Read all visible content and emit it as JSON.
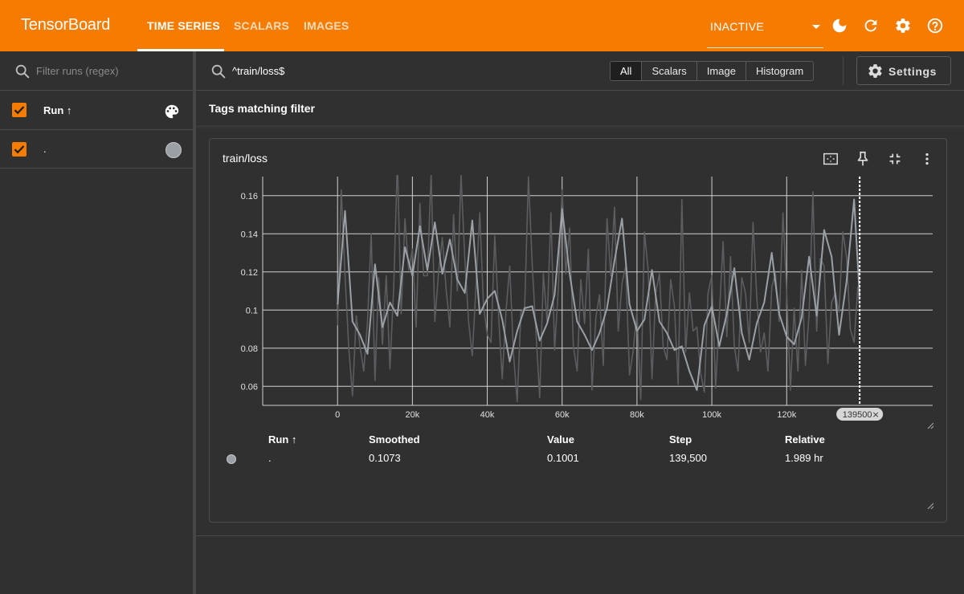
{
  "app": {
    "title": "TensorBoard"
  },
  "nav": {
    "tabs": [
      {
        "label": "TIME SERIES",
        "active": true
      },
      {
        "label": "SCALARS",
        "active": false
      },
      {
        "label": "IMAGES",
        "active": false
      }
    ],
    "reload_select": "INACTIVE",
    "icons": [
      "dark-mode-icon",
      "refresh-icon",
      "settings-icon",
      "help-icon"
    ]
  },
  "runs_panel": {
    "filter_placeholder": "Filter runs (regex)",
    "header_label": "Run ↑",
    "runs": [
      {
        "name": ".",
        "checked": true,
        "color": "#9aa0a6"
      }
    ]
  },
  "filter": {
    "query": "^train/loss$",
    "types": [
      "All",
      "Scalars",
      "Image",
      "Histogram"
    ],
    "active_type": "All",
    "settings_label": "Settings"
  },
  "section": {
    "title": "Tags matching filter"
  },
  "card": {
    "title": "train/loss",
    "icons": [
      "fit-domain-icon",
      "pin-icon",
      "collapse-icon",
      "more-vert-icon"
    ],
    "hover_step_chip": "139500",
    "table": {
      "headers": [
        "Run ↑",
        "Smoothed",
        "Value",
        "Step",
        "Relative"
      ],
      "rows": [
        {
          "run": ".",
          "smoothed": "0.1073",
          "value": "0.1001",
          "step": "139,500",
          "relative": "1.989 hr"
        }
      ]
    }
  },
  "colors": {
    "accent": "#f57c00",
    "series": "#9aa0a6",
    "raw_series": "#5b5d60"
  },
  "chart_data": {
    "type": "line",
    "title": "train/loss",
    "xlabel": "",
    "ylabel": "",
    "xlim": [
      -20000,
      159000
    ],
    "ylim": [
      0.05,
      0.17
    ],
    "x_ticks": [
      "0",
      "20k",
      "40k",
      "60k",
      "80k",
      "100k",
      "120k"
    ],
    "x_tick_values": [
      0,
      20000,
      40000,
      60000,
      80000,
      100000,
      120000
    ],
    "y_ticks": [
      "0.06",
      "0.08",
      "0.1",
      "0.12",
      "0.14",
      "0.16"
    ],
    "y_tick_values": [
      0.06,
      0.08,
      0.1,
      0.12,
      0.14,
      0.16
    ],
    "hover_step": 139500,
    "grid": true,
    "series": [
      {
        "name": "Smoothed",
        "x": [
          0,
          2000,
          4000,
          6000,
          8000,
          10000,
          12000,
          14000,
          16000,
          18000,
          20000,
          22000,
          24000,
          26000,
          28000,
          30000,
          32000,
          34000,
          36000,
          38000,
          40000,
          42000,
          44000,
          46000,
          48000,
          50000,
          52000,
          54000,
          56000,
          58000,
          60000,
          62000,
          64000,
          66000,
          68000,
          70000,
          72000,
          74000,
          76000,
          78000,
          80000,
          82000,
          84000,
          86000,
          88000,
          90000,
          92000,
          94000,
          96000,
          98000,
          100000,
          102000,
          104000,
          106000,
          108000,
          110000,
          112000,
          114000,
          116000,
          118000,
          120000,
          122000,
          124000,
          126000,
          128000,
          130000,
          132000,
          134000,
          136000,
          138000,
          139500
        ],
        "values": [
          0.103,
          0.152,
          0.094,
          0.087,
          0.077,
          0.124,
          0.091,
          0.104,
          0.097,
          0.133,
          0.118,
          0.144,
          0.121,
          0.146,
          0.119,
          0.137,
          0.116,
          0.109,
          0.147,
          0.098,
          0.106,
          0.11,
          0.095,
          0.073,
          0.089,
          0.101,
          0.102,
          0.084,
          0.093,
          0.108,
          0.153,
          0.119,
          0.094,
          0.087,
          0.079,
          0.088,
          0.101,
          0.126,
          0.148,
          0.103,
          0.089,
          0.095,
          0.121,
          0.094,
          0.088,
          0.079,
          0.081,
          0.068,
          0.058,
          0.092,
          0.102,
          0.081,
          0.098,
          0.122,
          0.088,
          0.074,
          0.093,
          0.104,
          0.13,
          0.098,
          0.086,
          0.082,
          0.096,
          0.128,
          0.097,
          0.142,
          0.128,
          0.087,
          0.115,
          0.158,
          0.107
        ]
      },
      {
        "name": "Value",
        "x": [
          0,
          1000,
          2000,
          3000,
          4000,
          5000,
          6000,
          7000,
          8000,
          9000,
          10000,
          11000,
          12000,
          13000,
          14000,
          15000,
          16000,
          17000,
          18000,
          19000,
          20000,
          21000,
          22000,
          23000,
          24000,
          25000,
          26000,
          27000,
          28000,
          29000,
          30000,
          31000,
          32000,
          33000,
          34000,
          35000,
          36000,
          37000,
          38000,
          39000,
          40000,
          41000,
          42000,
          43000,
          44000,
          45000,
          46000,
          47000,
          48000,
          49000,
          50000,
          51000,
          52000,
          53000,
          54000,
          55000,
          56000,
          57000,
          58000,
          59000,
          60000,
          61000,
          62000,
          63000,
          64000,
          65000,
          66000,
          67000,
          68000,
          69000,
          70000,
          71000,
          72000,
          73000,
          74000,
          75000,
          76000,
          77000,
          78000,
          79000,
          80000,
          81000,
          82000,
          83000,
          84000,
          85000,
          86000,
          87000,
          88000,
          89000,
          90000,
          91000,
          92000,
          93000,
          94000,
          95000,
          96000,
          97000,
          98000,
          99000,
          100000,
          101000,
          102000,
          103000,
          104000,
          105000,
          106000,
          107000,
          108000,
          109000,
          110000,
          111000,
          112000,
          113000,
          114000,
          115000,
          116000,
          117000,
          118000,
          119000,
          120000,
          121000,
          122000,
          123000,
          124000,
          125000,
          126000,
          127000,
          128000,
          129000,
          130000,
          131000,
          132000,
          133000,
          134000,
          135000,
          136000,
          137000,
          138000,
          139000,
          139500
        ],
        "values": [
          0.092,
          0.163,
          0.118,
          0.08,
          0.055,
          0.097,
          0.081,
          0.068,
          0.094,
          0.14,
          0.063,
          0.117,
          0.082,
          0.118,
          0.069,
          0.112,
          0.178,
          0.098,
          0.148,
          0.121,
          0.132,
          0.091,
          0.156,
          0.118,
          0.118,
          0.172,
          0.094,
          0.12,
          0.138,
          0.111,
          0.091,
          0.15,
          0.11,
          0.171,
          0.127,
          0.094,
          0.076,
          0.113,
          0.151,
          0.102,
          0.087,
          0.083,
          0.139,
          0.098,
          0.064,
          0.099,
          0.123,
          0.077,
          0.052,
          0.099,
          0.101,
          0.17,
          0.124,
          0.089,
          0.054,
          0.119,
          0.094,
          0.151,
          0.079,
          0.112,
          0.163,
          0.119,
          0.143,
          0.081,
          0.068,
          0.116,
          0.093,
          0.132,
          0.058,
          0.096,
          0.108,
          0.071,
          0.148,
          0.118,
          0.154,
          0.089,
          0.114,
          0.123,
          0.066,
          0.079,
          0.099,
          0.053,
          0.141,
          0.121,
          0.064,
          0.109,
          0.119,
          0.081,
          0.074,
          0.116,
          0.102,
          0.061,
          0.158,
          0.078,
          0.109,
          0.089,
          0.091,
          0.067,
          0.057,
          0.109,
          0.118,
          0.059,
          0.097,
          0.136,
          0.086,
          0.128,
          0.081,
          0.068,
          0.117,
          0.109,
          0.083,
          0.146,
          0.107,
          0.078,
          0.088,
          0.068,
          0.112,
          0.119,
          0.094,
          0.151,
          0.109,
          0.058,
          0.101,
          0.068,
          0.121,
          0.071,
          0.098,
          0.162,
          0.089,
          0.127,
          0.123,
          0.072,
          0.104,
          0.109,
          0.099,
          0.141,
          0.128,
          0.09,
          0.083,
          0.112,
          0.101
        ]
      }
    ]
  }
}
